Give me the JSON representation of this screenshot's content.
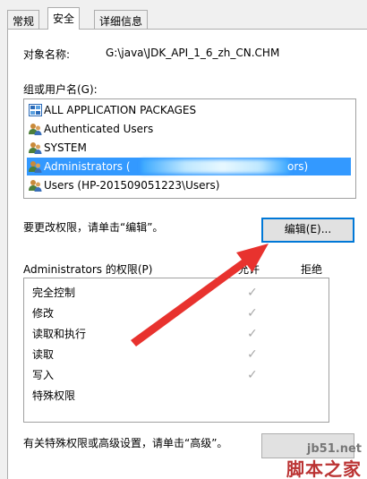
{
  "tabs": [
    "常规",
    "安全",
    "详细信息"
  ],
  "object_name_label": "对象名称:",
  "object_name_value": "G:\\java\\JDK_API_1_6_zh_CN.CHM",
  "group_label": "组或用户名(G):",
  "users": [
    {
      "name": "ALL APPLICATION PACKAGES",
      "icon": "app-packages-icon"
    },
    {
      "name": "Authenticated Users",
      "icon": "users-group-icon"
    },
    {
      "name": "SYSTEM",
      "icon": "users-group-icon"
    },
    {
      "name": "Administrators (",
      "name_suffix": "ors)",
      "icon": "users-group-icon",
      "selected": true
    },
    {
      "name": "Users (HP-201509051223\\Users)",
      "icon": "users-group-icon"
    }
  ],
  "change_perm_text": "要更改权限，请单击“编辑”。",
  "edit_button": "编辑(E)...",
  "perm_header": "Administrators 的权限(P)",
  "allow_header": "允许",
  "deny_header": "拒绝",
  "permissions": [
    {
      "name": "完全控制",
      "allow": true
    },
    {
      "name": "修改",
      "allow": true
    },
    {
      "name": "读取和执行",
      "allow": true
    },
    {
      "name": "读取",
      "allow": true
    },
    {
      "name": "写入",
      "allow": true
    },
    {
      "name": "特殊权限",
      "allow": false
    }
  ],
  "advanced_text": "有关特殊权限或高级设置，请单击“高级”。",
  "watermark": {
    "site": "jb51.net",
    "brand": "脚本之家"
  },
  "colors": {
    "selection": "#3399ff",
    "arrow": "#e8322e"
  }
}
